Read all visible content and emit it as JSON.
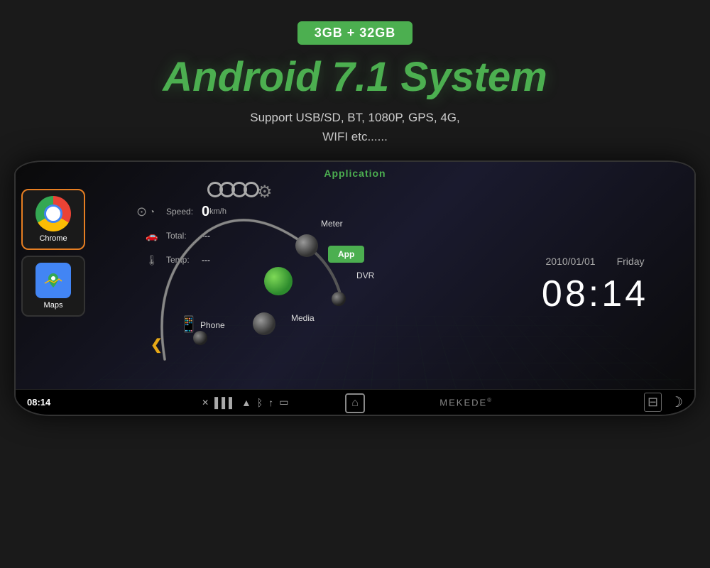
{
  "header": {
    "storage_badge": "3GB + 32GB",
    "title": "Android 7.1 System",
    "support_text_line1": "Support USB/SD,  BT,  1080P,  GPS,  4G,",
    "support_text_line2": "WIFI etc......"
  },
  "screen": {
    "app_bar_title": "Application",
    "apps": [
      {
        "name": "Chrome",
        "type": "chrome"
      },
      {
        "name": "Maps",
        "type": "maps"
      }
    ],
    "dashboard": {
      "speed_label": "Speed:",
      "speed_value": "0",
      "speed_unit": "km/h",
      "total_label": "Total:",
      "total_value": "---",
      "temp_label": "Temp:",
      "temp_value": "---"
    },
    "menu_items": [
      {
        "label": "Meter",
        "position": "top-right"
      },
      {
        "label": "DVR",
        "position": "middle-right"
      },
      {
        "label": "App",
        "position": "center",
        "highlighted": true
      },
      {
        "label": "Media",
        "position": "bottom-right"
      },
      {
        "label": "Phone",
        "position": "bottom-center"
      }
    ],
    "clock": {
      "date": "2010/01/01",
      "day": "Friday",
      "time": "08:14"
    },
    "status_bar": {
      "time": "08:14",
      "brand": "MEKEDE"
    }
  }
}
